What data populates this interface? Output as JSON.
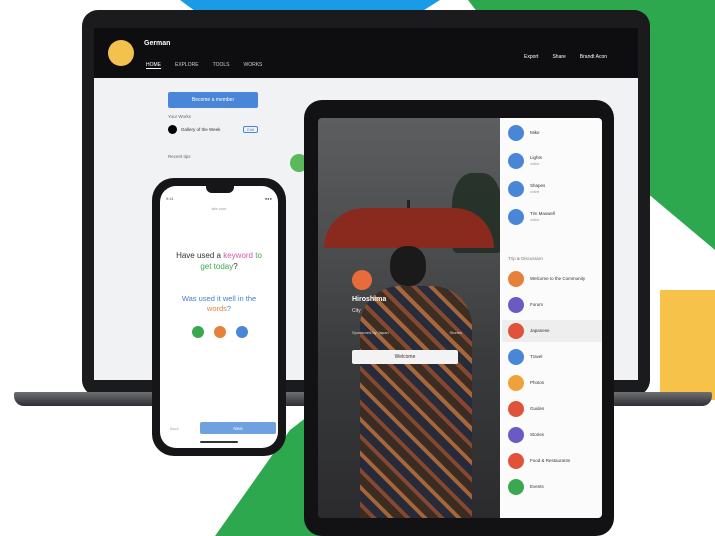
{
  "colors": {
    "blue": "#1a9be6",
    "green": "#2ea84e",
    "yellow": "#f7c24a",
    "accent_button": "#4a86d8"
  },
  "laptop": {
    "user_name": "German",
    "nav": [
      "HOME",
      "EXPLORE",
      "TOOLS",
      "WORKS"
    ],
    "top_right": [
      "Export",
      "Share",
      "Brandt Acon"
    ],
    "button_label": "Become a member",
    "panel_label": "Your Works",
    "row_label": "Gallery of the Week",
    "mini_button": "Edit",
    "section_label": "Recent tips"
  },
  "tablet": {
    "overlay_name": "Hiroshima",
    "overlay_sub": "City",
    "meta_left": "Sponsored by Japan",
    "meta_right": "Stories",
    "welcome_button": "Welcome",
    "side_top": [
      {
        "label": "Mike",
        "sub": "",
        "color": "#4a86d8"
      },
      {
        "label": "Lights",
        "sub": "online",
        "color": "#4a86d8"
      },
      {
        "label": "Shapes",
        "sub": "online",
        "color": "#4a86d8"
      },
      {
        "label": "Tim Maxwell",
        "sub": "online",
        "color": "#4a86d8"
      }
    ],
    "side_section_title": "Trip & Discussion",
    "side_items": [
      {
        "label": "Welcome to the Community",
        "color": "#e6803a"
      },
      {
        "label": "Forum",
        "color": "#6a5bc4"
      },
      {
        "label": "Japanese",
        "color": "#e0523a"
      },
      {
        "label": "Travel",
        "color": "#4a86d8"
      },
      {
        "label": "Photos",
        "color": "#f0a23a"
      },
      {
        "label": "Guides",
        "color": "#e0523a"
      },
      {
        "label": "Stories",
        "color": "#6a5bc4"
      },
      {
        "label": "Food & Restaurants",
        "color": "#e0523a"
      },
      {
        "label": "Events",
        "color": "#3aa850"
      }
    ]
  },
  "phone": {
    "status_left": "9:41",
    "status_right": "●●●",
    "url": "site.com",
    "q1_a": "Have used a",
    "q1_b": "keyword",
    "q1_c": " to get today",
    "q1_d": "?",
    "q2_a": "Was used it well in the ",
    "q2_b": "words",
    "q2_c": "?",
    "prev": "Back",
    "next": "Next",
    "circle_colors": [
      "#3aa850",
      "#e6803a",
      "#4a86d8"
    ]
  }
}
